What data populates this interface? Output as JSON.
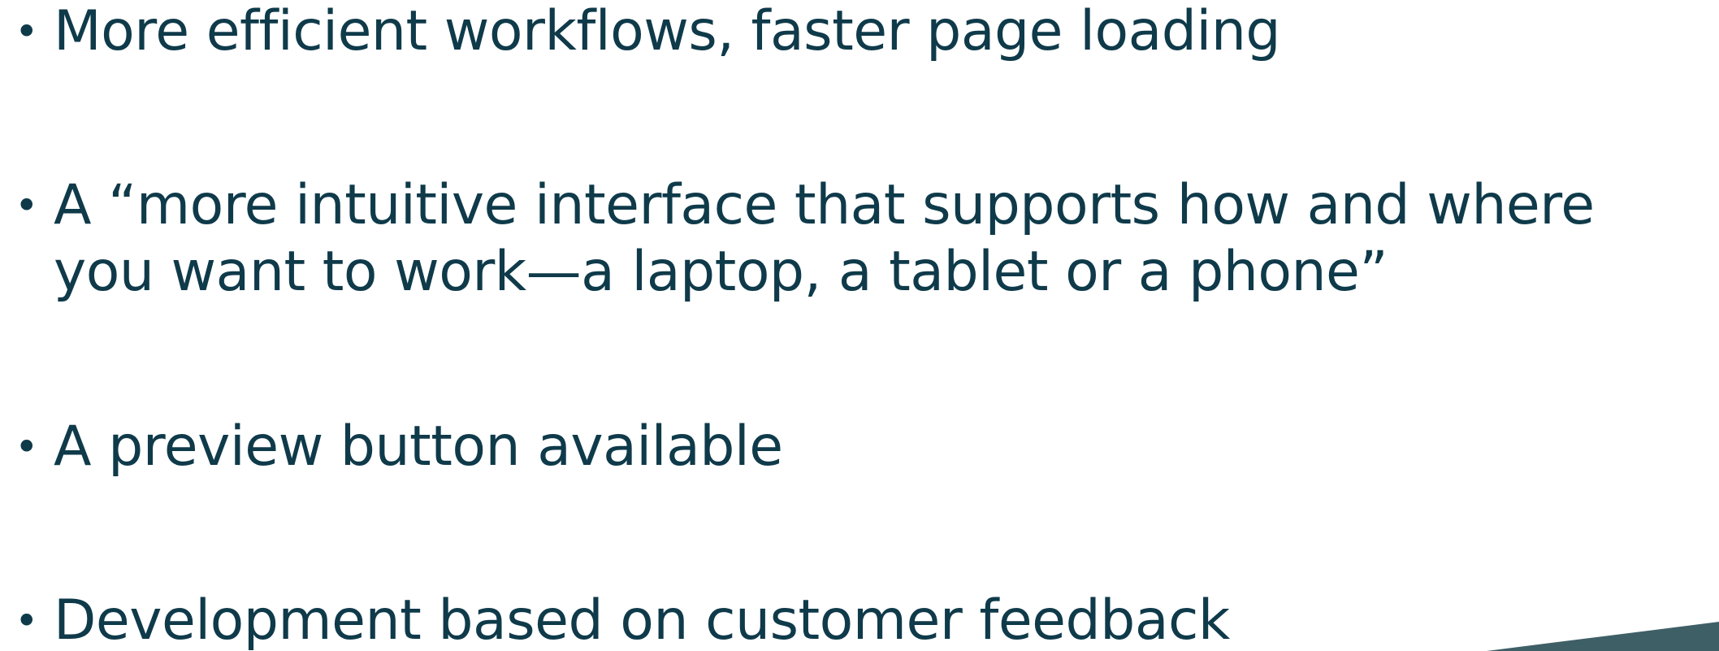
{
  "bullets": [
    {
      "lines": [
        "More efficient workflows, faster page loading"
      ]
    },
    {
      "lines": [
        "A “more intuitive interface that supports how and where",
        "you want to work—a laptop, a tablet or a phone”"
      ]
    },
    {
      "lines": [
        "A preview button available"
      ]
    },
    {
      "lines": [
        "Development based on customer feedback"
      ]
    }
  ],
  "colors": {
    "text": "#0f3a4a",
    "accent": "#3f5f66"
  },
  "bullet_symbol": "•"
}
